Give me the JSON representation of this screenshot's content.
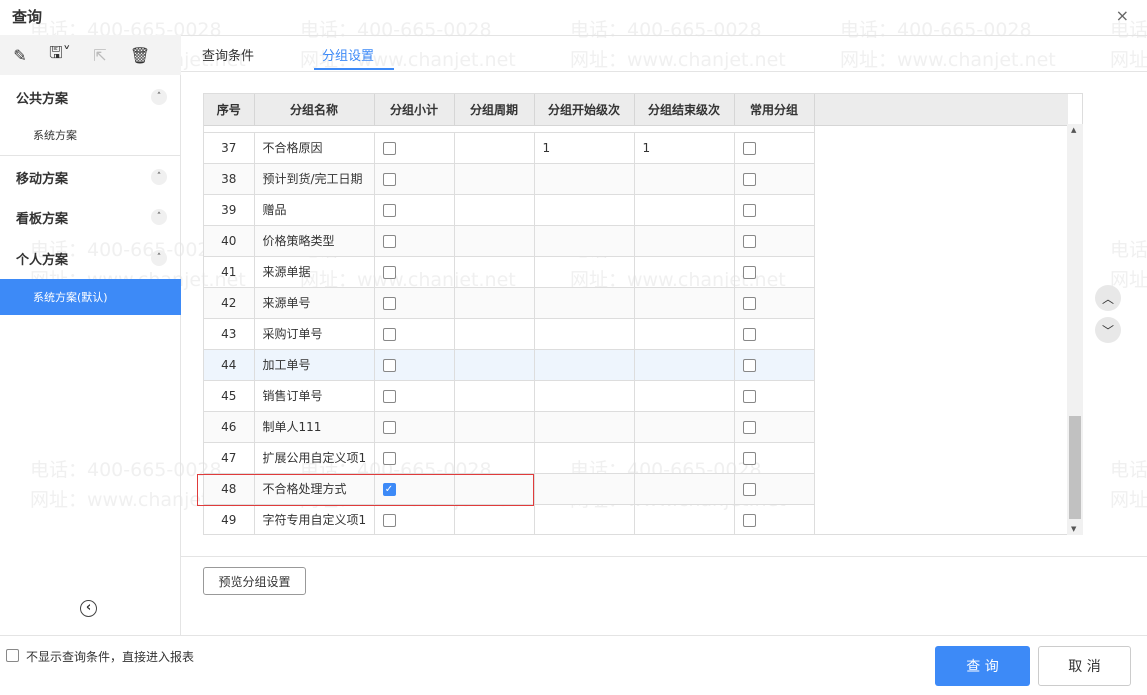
{
  "window": {
    "title": "查询",
    "close": "×"
  },
  "toolbar": {
    "edit": "✎",
    "save": "🖫˅",
    "export": "⇱",
    "delete": "🗑"
  },
  "sidebar": {
    "groups": [
      {
        "label": "公共方案",
        "items": [
          "系统方案"
        ]
      },
      {
        "label": "移动方案",
        "items": []
      },
      {
        "label": "看板方案",
        "items": []
      },
      {
        "label": "个人方案",
        "items": [
          "系统方案(默认)"
        ]
      }
    ],
    "chevron": "˄",
    "collapse": "‹"
  },
  "tabs": [
    {
      "label": "查询条件"
    },
    {
      "label": "分组设置",
      "active": true
    }
  ],
  "table": {
    "columns": [
      "序号",
      "分组名称",
      "分组小计",
      "分组周期",
      "分组开始级次",
      "分组结束级次",
      "常用分组"
    ],
    "rows": [
      {
        "no": "37",
        "name": "不合格原因",
        "subtotal": false,
        "period": "",
        "start": "1",
        "end": "1",
        "common": false
      },
      {
        "no": "38",
        "name": "预计到货/完工日期",
        "subtotal": false,
        "period": "",
        "start": "",
        "end": "",
        "common": false
      },
      {
        "no": "39",
        "name": "赠品",
        "subtotal": false,
        "period": "",
        "start": "",
        "end": "",
        "common": false
      },
      {
        "no": "40",
        "name": "价格策略类型",
        "subtotal": false,
        "period": "",
        "start": "",
        "end": "",
        "common": false
      },
      {
        "no": "41",
        "name": "来源单据",
        "subtotal": false,
        "period": "",
        "start": "",
        "end": "",
        "common": false
      },
      {
        "no": "42",
        "name": "来源单号",
        "subtotal": false,
        "period": "",
        "start": "",
        "end": "",
        "common": false
      },
      {
        "no": "43",
        "name": "采购订单号",
        "subtotal": false,
        "period": "",
        "start": "",
        "end": "",
        "common": false
      },
      {
        "no": "44",
        "name": "加工单号",
        "subtotal": false,
        "period": "",
        "start": "",
        "end": "",
        "common": false
      },
      {
        "no": "45",
        "name": "销售订单号",
        "subtotal": false,
        "period": "",
        "start": "",
        "end": "",
        "common": false
      },
      {
        "no": "46",
        "name": "制单人111",
        "subtotal": false,
        "period": "",
        "start": "",
        "end": "",
        "common": false
      },
      {
        "no": "47",
        "name": "扩展公用自定义项1",
        "subtotal": false,
        "period": "",
        "start": "",
        "end": "",
        "common": false
      },
      {
        "no": "48",
        "name": "不合格处理方式",
        "subtotal": true,
        "period": "",
        "start": "",
        "end": "",
        "common": false
      },
      {
        "no": "49",
        "name": "字符专用自定义项1",
        "subtotal": false,
        "period": "",
        "start": "",
        "end": "",
        "common": false
      }
    ]
  },
  "move": {
    "up": "︿",
    "down": "﹀"
  },
  "preview_button": "预览分组设置",
  "footer": {
    "skip_label": "不显示查询条件，直接进入报表",
    "query": "查 询",
    "cancel": "取 消"
  },
  "watermark": {
    "phone": "电话：400-665-0028",
    "site": "网址：www.chanjet.net"
  },
  "colors": {
    "accent": "#3d8af7",
    "highlight": "#e03b3b"
  }
}
